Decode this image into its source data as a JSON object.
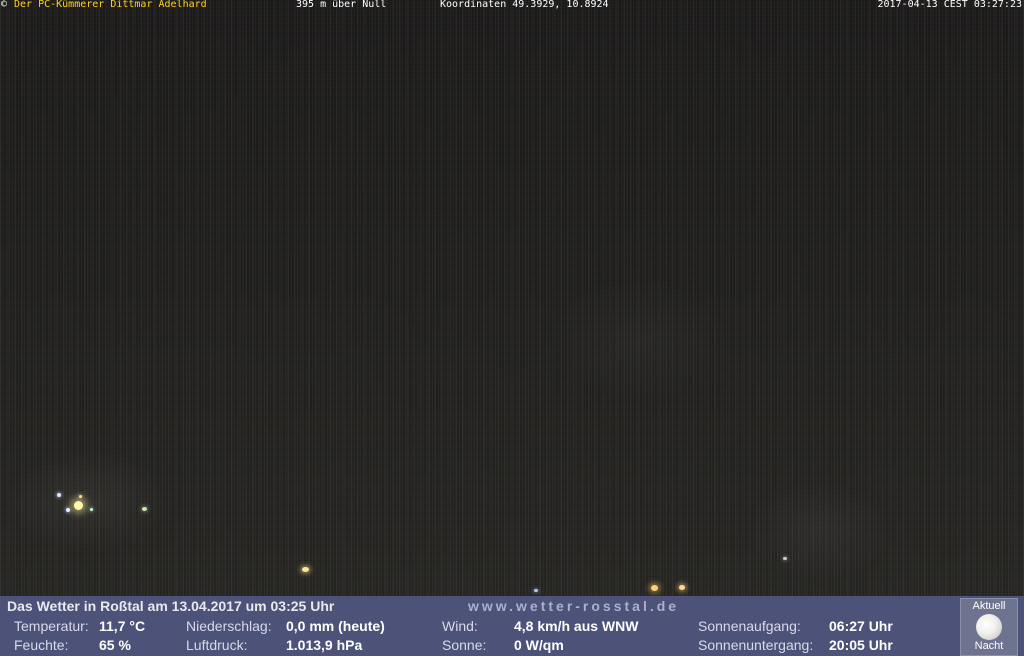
{
  "overlay": {
    "copyright_symbol": "©",
    "owner": "Der PC-Kümmerer Dittmar Adelhard",
    "altitude": "395 m über Null",
    "coordinates": "Koordinaten 49.3929, 10.8924",
    "timestamp": "2017-04-13 CEST 03:27:23"
  },
  "weather": {
    "title": "Das Wetter in Roßtal am 13.04.2017 um 03:25 Uhr",
    "website": "www.wetter-rosstal.de",
    "temperature_label": "Temperatur:",
    "temperature_value": "11,7 °C",
    "humidity_label": "Feuchte:",
    "humidity_value": "65 %",
    "precip_label": "Niederschlag:",
    "precip_value": "0,0 mm (heute)",
    "pressure_label": "Luftdruck:",
    "pressure_value": "1.013,9 hPa",
    "wind_label": "Wind:",
    "wind_value": "4,8 km/h aus WNW",
    "sun_label": "Sonne:",
    "sun_value": "0 W/qm",
    "sunrise_label": "Sonnenaufgang:",
    "sunrise_value": "06:27 Uhr",
    "sunset_label": "Sonnenuntergang:",
    "sunset_value": "20:05 Uhr"
  },
  "moon": {
    "header": "Aktuell",
    "footer": "Nacht",
    "icon": "moon-icon"
  },
  "colors": {
    "panel_background": "#4d5279",
    "owner_text": "#ffd21a"
  }
}
